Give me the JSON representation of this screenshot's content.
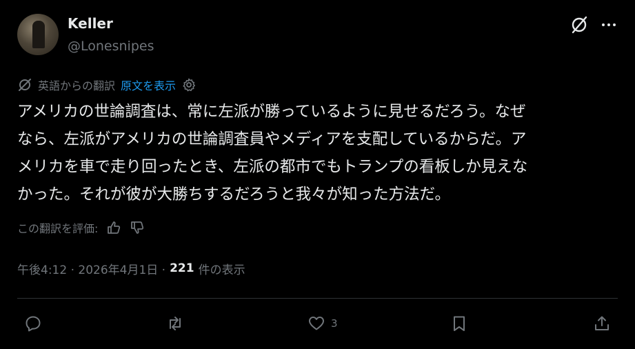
{
  "post": {
    "author_name": "Keller",
    "author_handle": "@Lonesnipes",
    "translation_note": "英語からの翻訳",
    "show_original": "原文を表示",
    "text": "アメリカの世論調査は、常に左派が勝っているように見せるだろう。なぜ\nなら、左派がアメリカの世論調査員やメディアを支配しているからだ。ア\nメリカを車で走り回ったとき、左派の都市でもトランプの看板しか見えな\nかった。それが彼が大勝ちするだろうと我々が知った方法だ。",
    "rate_translation": "この翻訳を評価:",
    "timestamp": "午後4:12 · 2026年4月1日 ·",
    "view_count": "221",
    "view_label": "件の表示"
  },
  "actions": {
    "reply_count": "",
    "repost_count": "",
    "like_count": "3",
    "bookmark_count": ""
  },
  "icons": {
    "grok": "grok-icon",
    "more": "more-icon",
    "reply": "reply-icon",
    "repost": "repost-icon",
    "like": "heart-icon",
    "bookmark": "bookmark-icon",
    "share": "share-icon"
  },
  "colors": {
    "background": "#000000",
    "text": "#e7e9ea",
    "muted": "#71767b",
    "link": "#1d9bf0",
    "divider": "#2f3336"
  }
}
